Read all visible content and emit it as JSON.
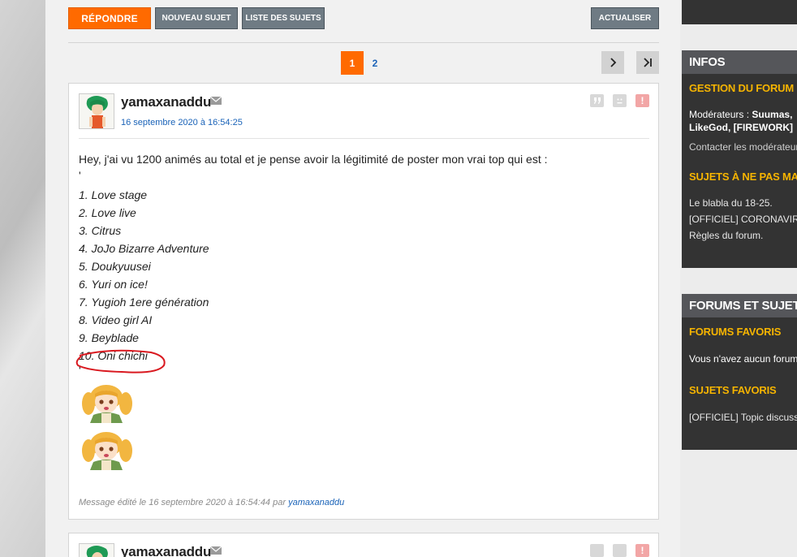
{
  "toolbar": {
    "reply_label": "RÉPONDRE",
    "new_topic_label": "NOUVEAU SUJET",
    "topic_list_label": "LISTE DES SUJETS",
    "refresh_label": "ACTUALISER"
  },
  "pagination": {
    "current": "1",
    "next": "2"
  },
  "post": {
    "author": "yamaxanaddu",
    "date": "16 septembre 2020 à 16:54:25",
    "intro": "Hey, j'ai vu 1200 animés au total et je pense avoir la légitimité de poster mon vrai top qui est :",
    "list": [
      "1. Love stage",
      "2. Love live",
      "3. Citrus",
      "4. JoJo Bizarre Adventure",
      "5. Doukyuusei",
      "6. Yuri on ice!",
      "7. Yugioh 1ere génération",
      "8. Video girl AI",
      "9. Beyblade",
      "10. Oni chichi"
    ],
    "edit_prefix": "Message édité le 16 septembre 2020 à 16:54:44 par",
    "edit_author": "yamaxanaddu"
  },
  "post2": {
    "author": "yamaxanaddu"
  },
  "sidebar": {
    "infos": {
      "title": "INFOS",
      "forum_mgmt": "GESTION DU FORUM",
      "moderators_label": "Modérateurs :",
      "moderators_line1": "Suumas,",
      "moderators_line2": "LikeGod, [FIREWORK]",
      "contact": "Contacter les modérateurs",
      "dont_miss": "SUJETS À NE PAS MANQUER",
      "topics": [
        "Le blabla du 18-25.",
        "[OFFICIEL] CORONAVIRUS",
        "Règles du forum."
      ]
    },
    "forums": {
      "title": "FORUMS ET SUJETS",
      "fav_forums": "FORUMS FAVORIS",
      "fav_forums_text": "Vous n'avez aucun forum favori",
      "fav_topics": "SUJETS FAVORIS",
      "fav_topics_text": "[OFFICIEL] Topic discussion"
    }
  },
  "colors": {
    "accent": "#ff6a00",
    "link": "#1a63b8",
    "sidebar_sub": "#f6b400",
    "annotation": "#d9181f"
  }
}
